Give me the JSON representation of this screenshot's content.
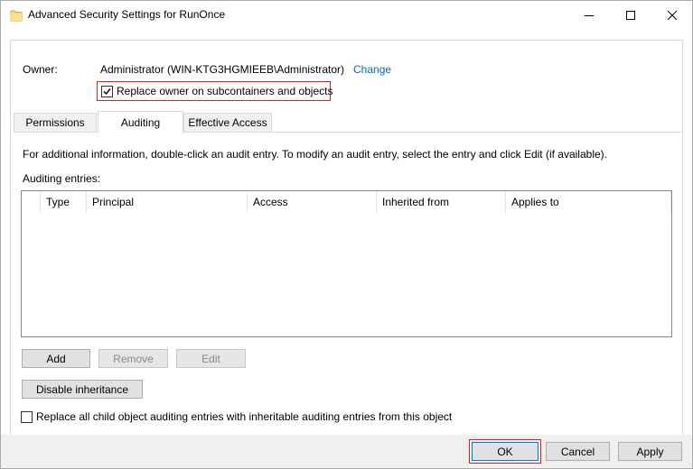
{
  "window": {
    "title": "Advanced Security Settings for RunOnce",
    "controls": [
      "minimize",
      "maximize",
      "close"
    ]
  },
  "owner": {
    "label": "Owner:",
    "value": "Administrator (WIN-KTG3HGMIEEB\\Administrator)",
    "change_link": "Change",
    "replace_subcontainers": {
      "label": "Replace owner on subcontainers and objects",
      "checked": true
    }
  },
  "tabs": [
    {
      "label": "Permissions",
      "active": false
    },
    {
      "label": "Auditing",
      "active": true
    },
    {
      "label": "Effective Access",
      "active": false
    }
  ],
  "auditing": {
    "info_text": "For additional information, double-click an audit entry. To modify an audit entry, select the entry and click Edit (if available).",
    "entries_label": "Auditing entries:",
    "columns": [
      "Type",
      "Principal",
      "Access",
      "Inherited from",
      "Applies to"
    ],
    "entries": [],
    "buttons": {
      "add": "Add",
      "remove": "Remove",
      "edit": "Edit",
      "disable_inheritance": "Disable inheritance"
    },
    "replace_child": {
      "label": "Replace all child object auditing entries with inheritable auditing entries from this object",
      "checked": false
    }
  },
  "footer": {
    "ok": "OK",
    "cancel": "Cancel",
    "apply": "Apply"
  },
  "colors": {
    "link": "#0066cc",
    "highlight": "#e21e1e",
    "accent": "#0078d7"
  }
}
